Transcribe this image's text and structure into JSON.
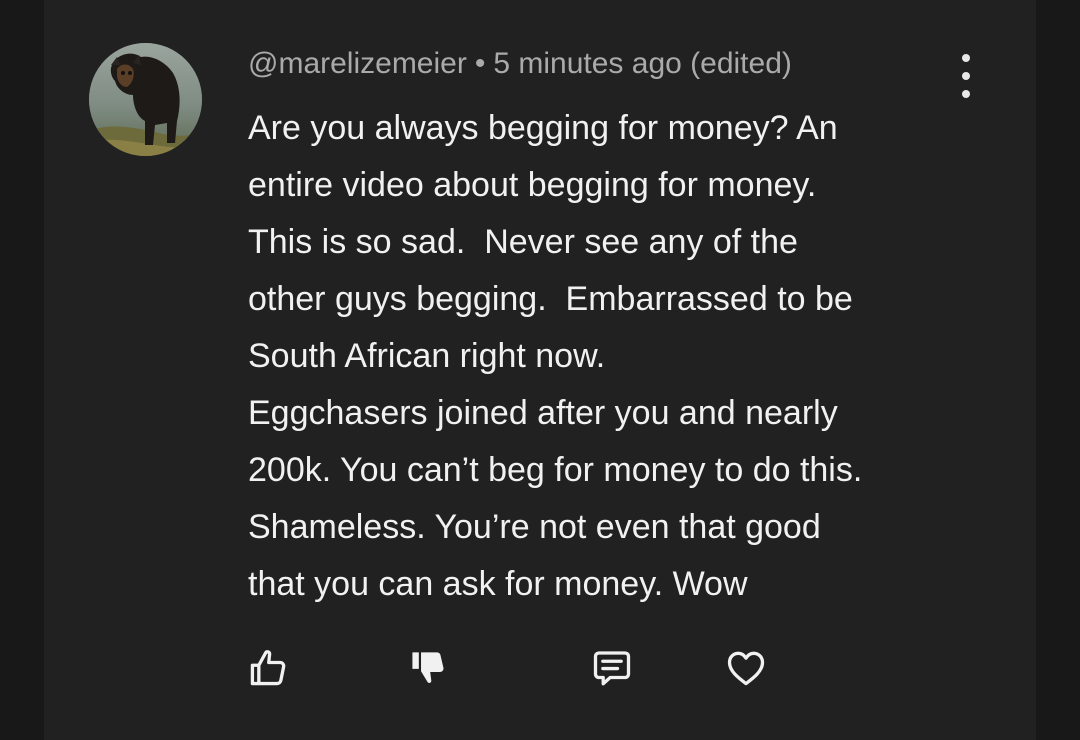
{
  "comment": {
    "author": "@marelizemeier",
    "separator": "•",
    "timestamp": "5 minutes ago (edited)",
    "lines": [
      "Are you always begging for money? An",
      "entire video about begging for money.",
      "This is so sad.  Never see any of the",
      "other guys begging.  Embarrassed to be",
      "South African right now.",
      "Eggchasers joined after you and nearly",
      "200k. You can’t beg for money to do this.",
      "Shameless. You’re not even that good",
      "that you can ask for money. Wow"
    ],
    "avatar_icon": "dog-photo-avatar",
    "menu_icon": "more-vertical-icon"
  },
  "actions": [
    {
      "icon": "thumbs-up-icon"
    },
    {
      "icon": "thumbs-down-icon"
    },
    {
      "icon": "reply-comment-icon"
    },
    {
      "icon": "heart-icon"
    }
  ],
  "colors": {
    "background": "#181818",
    "panel": "#212121",
    "text": "#f1f1f1",
    "meta_text": "#aaaaaa"
  }
}
